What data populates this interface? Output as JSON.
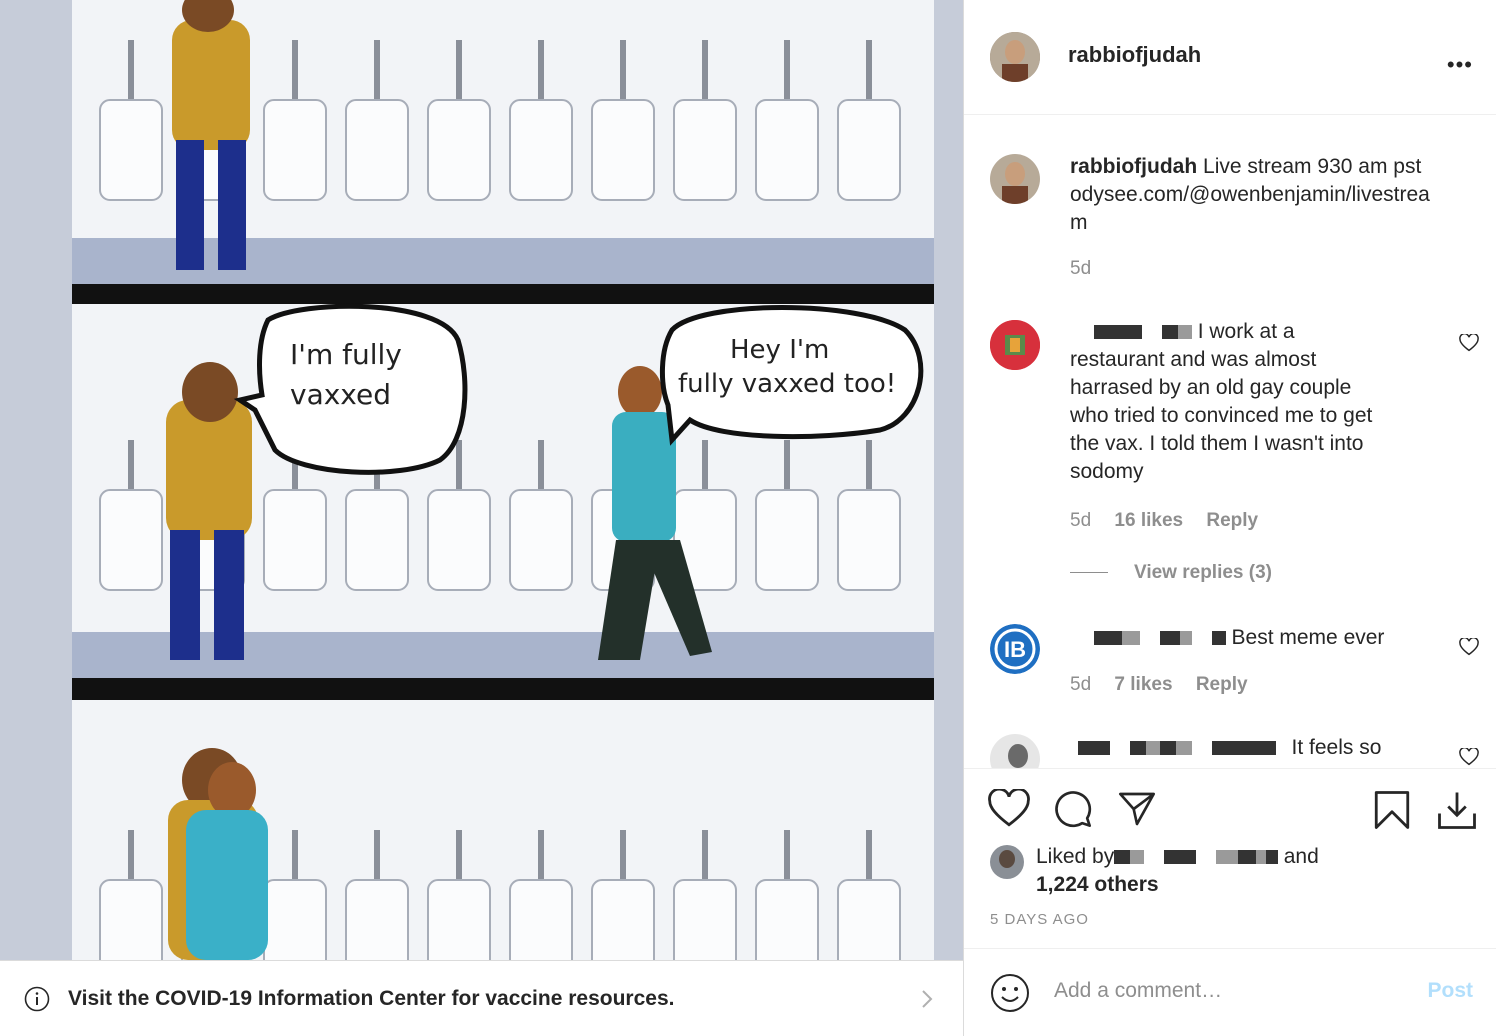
{
  "meme": {
    "bubble_left": [
      "I'm fully",
      "vaxxed"
    ],
    "bubble_right": [
      "Hey I'm",
      "fully vaxxed too!"
    ]
  },
  "notice": {
    "text": "Visit the COVID-19 Information Center for vaccine resources."
  },
  "post": {
    "username": "rabbiofjudah",
    "more_label": "•••",
    "caption_user": "rabbiofjudah",
    "caption_lines": [
      "Live stream 930 am pst",
      "odysee.com/@owenbenjamin/livestrea",
      "m"
    ],
    "caption_time": "5d"
  },
  "comments": [
    {
      "lines": [
        "I work at a",
        "restaurant and was almost",
        "harrased by an old gay couple",
        "who tried to convinced me to get",
        "the vax. I told them I wasn't into",
        "sodomy"
      ],
      "time": "5d",
      "likes": "16 likes",
      "reply": "Reply",
      "view_replies": "View replies (3)"
    },
    {
      "lines": [
        "Best meme ever"
      ],
      "time": "5d",
      "likes": "7 likes",
      "reply": "Reply"
    },
    {
      "lines": [
        "It feels so"
      ]
    }
  ],
  "likes": {
    "prefix": "Liked by",
    "and": "and",
    "others": "1,224 others"
  },
  "time_ago": "5 DAYS AGO",
  "add_comment": {
    "placeholder": "Add a comment…",
    "post_label": "Post"
  },
  "colors": {
    "accent": "#b2dffc",
    "secondary": "#8e8e8e"
  }
}
